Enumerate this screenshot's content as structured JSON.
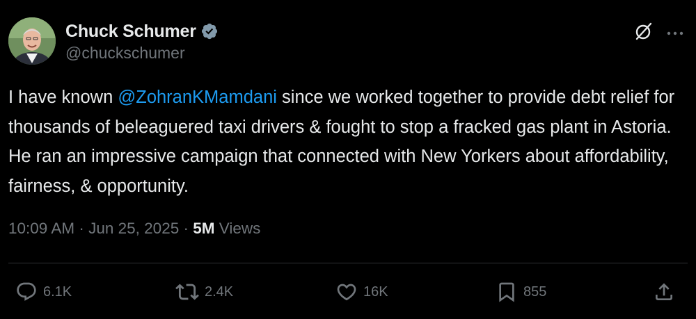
{
  "author": {
    "display_name": "Chuck Schumer",
    "handle": "@chuckschumer",
    "verified": true
  },
  "post": {
    "text_before_mention": "I have known ",
    "mention": "@ZohranKMamdani",
    "text_after_mention": " since we worked together to provide debt relief for thousands of beleaguered taxi drivers & fought to stop a fracked gas plant in Astoria. He ran an impressive campaign that connected with New Yorkers about affordability, fairness, & opportunity."
  },
  "meta": {
    "time": "10:09 AM",
    "separator": "·",
    "date": "Jun 25, 2025",
    "views_count": "5M",
    "views_label": "Views"
  },
  "engagement": {
    "replies": "6.1K",
    "reposts": "2.4K",
    "likes": "16K",
    "bookmarks": "855"
  },
  "icons": {
    "verified": "verified-badge-icon",
    "grok": "grok-icon",
    "more": "more-icon",
    "reply": "reply-icon",
    "repost": "repost-icon",
    "like": "like-icon",
    "bookmark": "bookmark-icon",
    "share": "share-icon"
  },
  "colors": {
    "background": "#000000",
    "primary_text": "#e7e9ea",
    "secondary_text": "#71767b",
    "link": "#1d9bf0",
    "divider": "#2f3336",
    "verified_badge": "#829aab"
  }
}
